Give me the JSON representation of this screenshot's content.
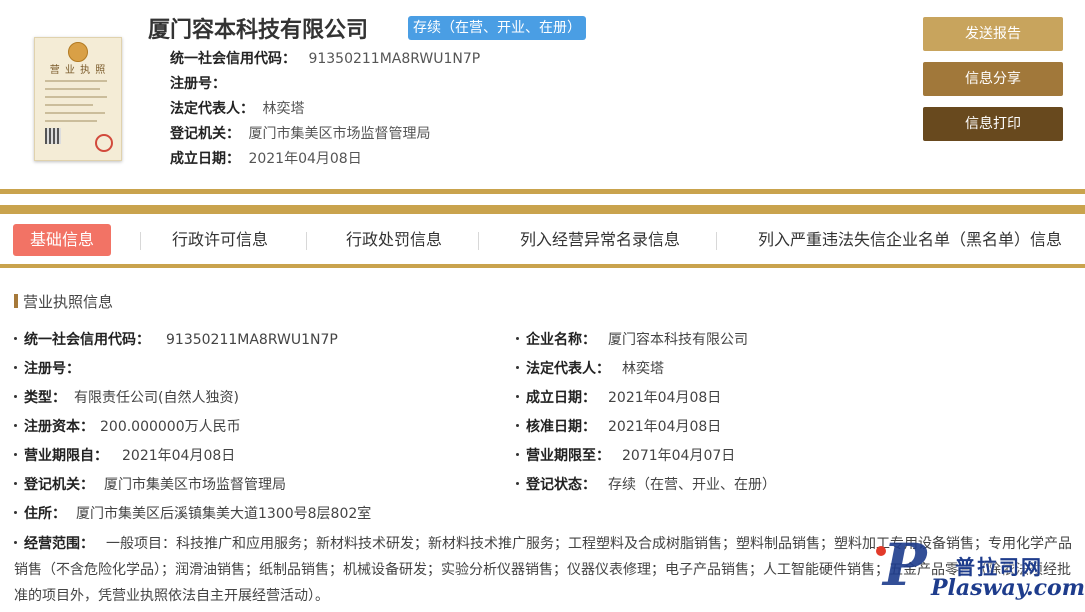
{
  "header": {
    "company_name": "厦门容本科技有限公司",
    "status_badge": "存续（在营、开业、在册）",
    "license_thumbnail_title": "营 业 执 照",
    "fields": [
      {
        "label": "统一社会信用代码：",
        "value": "91350211MA8RWU1N7P"
      },
      {
        "label": "注册号：",
        "value": ""
      },
      {
        "label": "法定代表人：",
        "value": "林奕塔"
      },
      {
        "label": "登记机关：",
        "value": "厦门市集美区市场监督管理局"
      },
      {
        "label": "成立日期：",
        "value": "2021年04月08日"
      }
    ]
  },
  "actions": {
    "send_report": "发送报告",
    "share_info": "信息分享",
    "print_info": "信息打印"
  },
  "tabs": [
    {
      "label": "基础信息",
      "active": true
    },
    {
      "label": "行政许可信息",
      "active": false
    },
    {
      "label": "行政处罚信息",
      "active": false
    },
    {
      "label": "列入经营异常名录信息",
      "active": false
    },
    {
      "label": "列入严重违法失信企业名单（黑名单）信息",
      "active": false
    }
  ],
  "section": {
    "title": "营业执照信息",
    "left": [
      {
        "label": "统一社会信用代码：",
        "value": "91350211MA8RWU1N7P"
      },
      {
        "label": "注册号：",
        "value": ""
      },
      {
        "label": "类型：",
        "value": "有限责任公司(自然人独资)"
      },
      {
        "label": "注册资本：",
        "value": "200.000000万人民币"
      },
      {
        "label": "营业期限自：",
        "value": "2021年04月08日"
      },
      {
        "label": "登记机关：",
        "value": "厦门市集美区市场监督管理局"
      },
      {
        "label": "住所：",
        "value": "厦门市集美区后溪镇集美大道1300号8层802室"
      }
    ],
    "right": [
      {
        "label": "企业名称：",
        "value": "厦门容本科技有限公司"
      },
      {
        "label": "法定代表人：",
        "value": "林奕塔"
      },
      {
        "label": "成立日期：",
        "value": "2021年04月08日"
      },
      {
        "label": "核准日期：",
        "value": "2021年04月08日"
      },
      {
        "label": "营业期限至：",
        "value": "2071年04月07日"
      },
      {
        "label": "登记状态：",
        "value": "存续（在营、开业、在册）"
      }
    ],
    "scope_label": "经营范围：",
    "scope_text": "一般项目：科技推广和应用服务；新材料技术研发；新材料技术推广服务；工程塑料及合成树脂销售；塑料制品销售；塑料加工专用设备销售；专用化学产品销售（不含危险化学品）；润滑油销售；纸制品销售；机械设备研发；实验分析仪器销售；仪器仪表修理；电子产品销售；人工智能硬件销售；五金产品零售（除依法须经批准的项目外，凭营业执照依法自主开展经营活动）。"
  },
  "watermark": {
    "cn": "普拉司网",
    "en": "Plasway.com"
  },
  "colors": {
    "gold_stripe": "#c9a34d",
    "active_tab": "#f27365",
    "badge_blue": "#4a9ee4",
    "btn1": "#c8a45d",
    "btn2": "#a1783a",
    "btn3": "#68491e"
  }
}
